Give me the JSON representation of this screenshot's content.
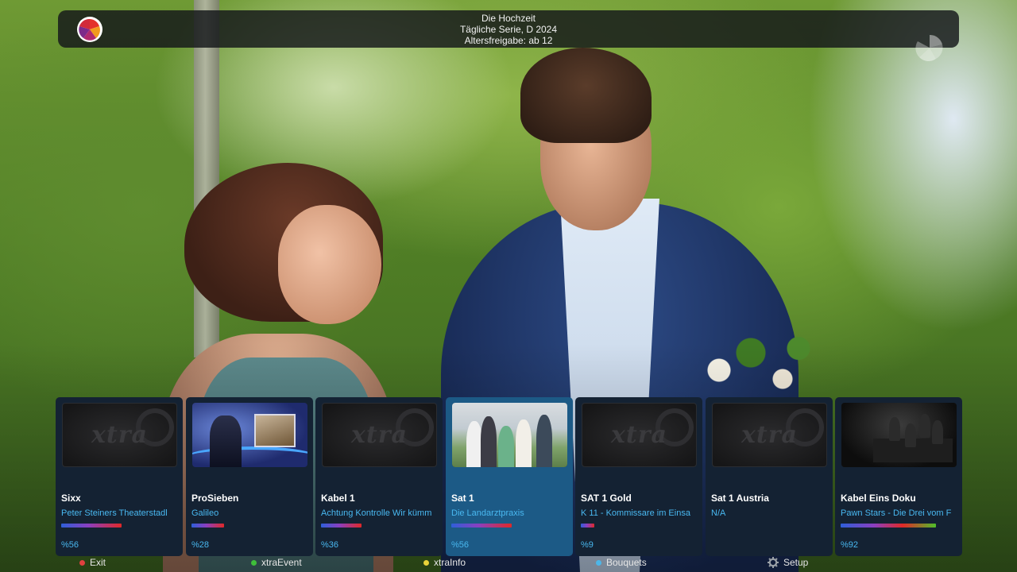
{
  "info_bar": {
    "title": "Die Hochzeit",
    "subtitle": "Tägliche Serie, D 2024",
    "rating": "Altersfreigabe: ab 12"
  },
  "channel_logo_icon": "sixx-logo",
  "watermark_icon": "sixx-watermark",
  "placeholder_text": "xtra",
  "cards": [
    {
      "channel": "Sixx",
      "show": "Peter Steiners Theaterstadl",
      "percent": "%56",
      "progress": 0.56,
      "thumb": "placeholder"
    },
    {
      "channel": "ProSieben",
      "show": "Galileo",
      "percent": "%28",
      "progress": 0.28,
      "thumb": "studio"
    },
    {
      "channel": "Kabel 1",
      "show": "Achtung Kontrolle Wir kümm",
      "percent": "%36",
      "progress": 0.36,
      "thumb": "placeholder"
    },
    {
      "channel": "Sat 1",
      "show": "Die Landarztpraxis",
      "percent": "%56",
      "progress": 0.56,
      "thumb": "outdoor",
      "selected": true
    },
    {
      "channel": "SAT 1 Gold",
      "show": "K 11 - Kommissare im Einsa",
      "percent": "%9",
      "progress": 0.09,
      "thumb": "placeholder"
    },
    {
      "channel": "Sat 1 Austria",
      "show": "N/A",
      "percent": "",
      "progress": 0,
      "thumb": "placeholder"
    },
    {
      "channel": "Kabel Eins Doku",
      "show": "Pawn Stars - Die Drei vom F",
      "percent": "%92",
      "progress": 0.92,
      "thumb": "dark"
    }
  ],
  "buttons": {
    "exit": {
      "label": "Exit",
      "color": "#e0413f"
    },
    "event": {
      "label": "xtraEvent",
      "color": "#3fbf3a"
    },
    "info": {
      "label": "xtraInfo",
      "color": "#e8d23a"
    },
    "bouquets": {
      "label": "Bouquets",
      "color": "#4db6e8"
    },
    "setup": {
      "label": "Setup",
      "icon": "gear-icon"
    }
  },
  "colors": {
    "card_bg": "#142233",
    "card_selected_bg": "#1c5a86",
    "accent_text": "#49b8f0"
  }
}
